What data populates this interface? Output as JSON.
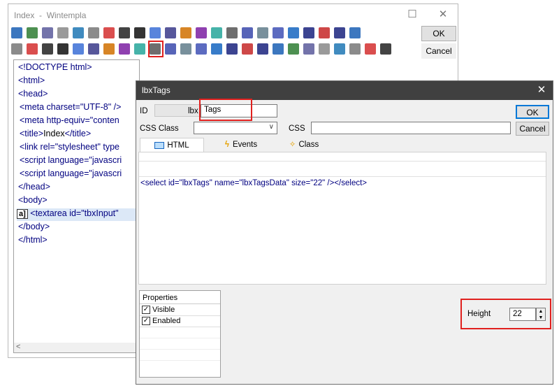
{
  "back_window": {
    "title": "Index  -  Wintempla",
    "minimize": "☐",
    "close": "✕",
    "ok": "OK",
    "cancel": "Cancel",
    "toolbar_icon_colors": [
      "#1a5fb4",
      "#2e7d32",
      "#5b5b9b",
      "#888",
      "#1f77b4",
      "#777",
      "#d32f2f",
      "#222",
      "#111",
      "#3b6fd6",
      "#3a3a8a",
      "#d07000",
      "#7b1fa2",
      "#26a69a",
      "#555",
      "#3949ab",
      "#607d8b",
      "#3f51b5",
      "#1565c0",
      "#1a237e",
      "#c62828",
      "#1a237e"
    ]
  },
  "code": {
    "l1": "<!DOCTYPE html>",
    "l2": "<html>",
    "l3": "<head>",
    "l4a": "<meta charset=\"UTF-8\" />",
    "l5": "<meta http-equiv=\"conten",
    "l6a": "<title>",
    "l6b": "Index",
    "l6c": "</title>",
    "l7": "<link rel=\"stylesheet\"  type",
    "l8": "<script language=\"javascri",
    "l9": "<script language=\"javascri",
    "l10": "</head>",
    "l11": "<body>",
    "l12": "<textarea id=\"tbxInput\"",
    "l13": "</body>",
    "l14": "</html>",
    "marker": "a]",
    "scroll_left": "<"
  },
  "dialog": {
    "title": "lbxTags",
    "close": "✕",
    "id_label": "ID",
    "prefix": "lbx",
    "id_value": "Tags",
    "ok": "OK",
    "css_class_label": "CSS Class",
    "css_label": "CSS",
    "cancel": "Cancel",
    "tabs": [
      "HTML",
      "Events",
      "Class"
    ],
    "html_code": "<select id=\"lbxTags\" name=\"lbxTagsData\" size=\"22\" />",
    "html_close": "</select>",
    "properties_header": "Properties",
    "visible": "Visible",
    "enabled": "Enabled",
    "height_label": "Height",
    "height_value": "22",
    "check": "✓"
  }
}
